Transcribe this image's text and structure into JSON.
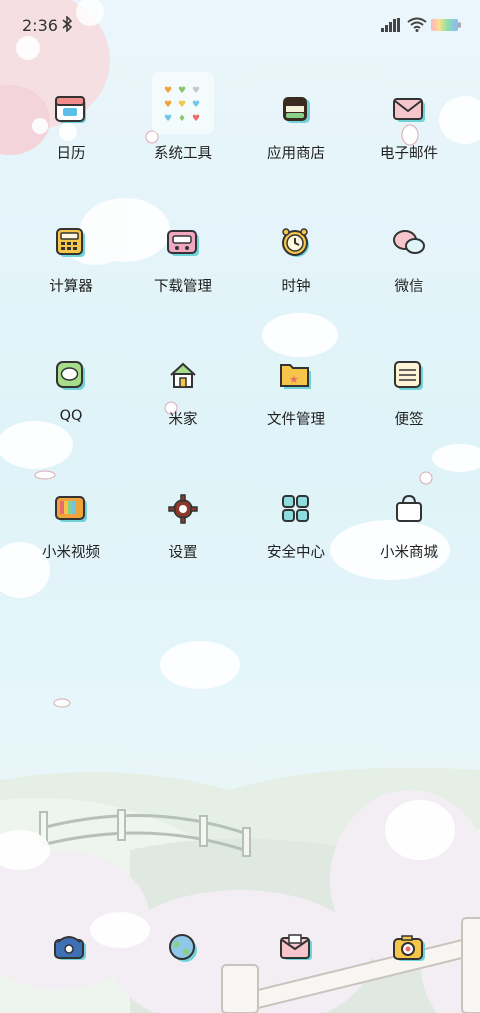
{
  "status_bar": {
    "time": "2:36",
    "icons": [
      "bluetooth-icon",
      "signal-icon",
      "wifi-icon",
      "battery-icon"
    ]
  },
  "apps": [
    {
      "label": "日历",
      "icon": "calendar-icon"
    },
    {
      "label": "系统工具",
      "icon": "folder-icon"
    },
    {
      "label": "应用商店",
      "icon": "app-store-icon"
    },
    {
      "label": "电子邮件",
      "icon": "email-icon"
    },
    {
      "label": "计算器",
      "icon": "calculator-icon"
    },
    {
      "label": "下载管理",
      "icon": "download-icon"
    },
    {
      "label": "时钟",
      "icon": "clock-icon"
    },
    {
      "label": "微信",
      "icon": "wechat-icon"
    },
    {
      "label": "QQ",
      "icon": "qq-icon"
    },
    {
      "label": "米家",
      "icon": "home-icon"
    },
    {
      "label": "文件管理",
      "icon": "file-manager-icon"
    },
    {
      "label": "便签",
      "icon": "notes-icon"
    },
    {
      "label": "小米视频",
      "icon": "tv-icon"
    },
    {
      "label": "设置",
      "icon": "gear-icon"
    },
    {
      "label": "安全中心",
      "icon": "security-icon"
    },
    {
      "label": "小米商城",
      "icon": "shopping-bag-icon"
    }
  ],
  "dock": [
    {
      "icon": "phone-icon"
    },
    {
      "icon": "globe-icon"
    },
    {
      "icon": "message-icon"
    },
    {
      "icon": "camera-icon"
    }
  ],
  "colors": {
    "sky": "#dff3f8",
    "cloud": "#ffffff",
    "blossom": "#f6d9de",
    "hill": "#e4efe8",
    "accent_cyan": "#6fd3d8",
    "text": "#222222"
  }
}
